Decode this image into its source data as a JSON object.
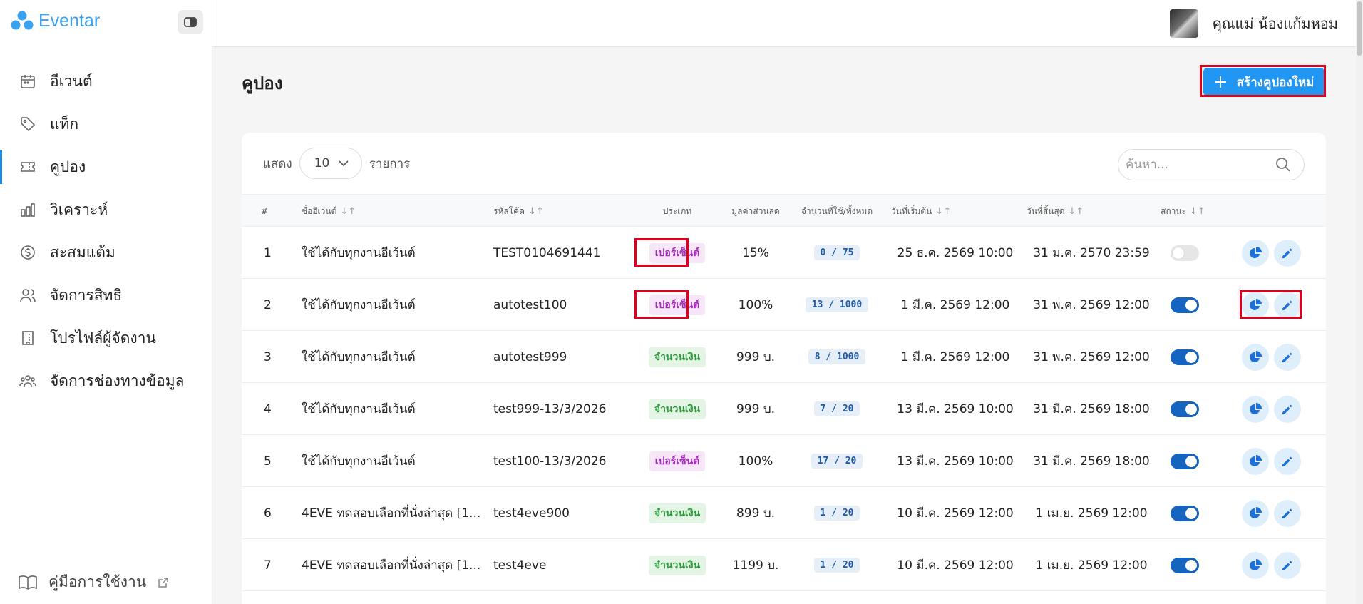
{
  "app": {
    "logo_text": "Eventar"
  },
  "sidebar": {
    "items": [
      {
        "label": "อีเวนต์",
        "icon": "calendar-icon",
        "active": false
      },
      {
        "label": "แท็ก",
        "icon": "tag-icon",
        "active": false
      },
      {
        "label": "คูปอง",
        "icon": "ticket-icon",
        "active": true
      },
      {
        "label": "วิเคราะห์",
        "icon": "bar-chart-icon",
        "active": false
      },
      {
        "label": "สะสมแต้ม",
        "icon": "dollar-circle-icon",
        "active": false
      },
      {
        "label": "จัดการสิทธิ",
        "icon": "users-icon",
        "active": false
      },
      {
        "label": "โปรไฟล์ผู้จัดงาน",
        "icon": "building-icon",
        "active": false
      },
      {
        "label": "จัดการช่องทางข้อมูล",
        "icon": "team-icon",
        "active": false
      }
    ],
    "guide_label": "คู่มือการใช้งาน"
  },
  "topbar": {
    "user_name": "คุณแม่ น้องแก้มหอม"
  },
  "page": {
    "title": "คูปอง",
    "create_label": "สร้างคูปองใหม่"
  },
  "controls": {
    "show_label": "แสดง",
    "page_size": "10",
    "items_label": "รายการ",
    "search_placeholder": "ค้นหา..."
  },
  "table": {
    "headers": {
      "num": "#",
      "event": "ชื่ออีเวนต์",
      "code": "รหัสโค้ด",
      "type": "ประเภท",
      "value": "มูลค่าส่วนลด",
      "usage": "จำนวนที่ใช้/ทั้งหมด",
      "start": "วันที่เริ่มต้น",
      "end": "วันที่สิ้นสุด",
      "status": "สถานะ"
    },
    "rows": [
      {
        "num": "1",
        "event": "ใช้ได้กับทุกงานอีเว้นต์",
        "code": "TEST0104691441",
        "type": "เปอร์เซ็นต์",
        "type_kind": "percent",
        "value": "15%",
        "usage": "0 / 75",
        "start": "25 ธ.ค. 2569 10:00",
        "end": "31 ม.ค. 2570 23:59",
        "status_on": false
      },
      {
        "num": "2",
        "event": "ใช้ได้กับทุกงานอีเว้นต์",
        "code": "autotest100",
        "type": "เปอร์เซ็นต์",
        "type_kind": "percent",
        "value": "100%",
        "usage": "13 / 1000",
        "start": "1 มี.ค. 2569 12:00",
        "end": "31 พ.ค. 2569 12:00",
        "status_on": true
      },
      {
        "num": "3",
        "event": "ใช้ได้กับทุกงานอีเว้นต์",
        "code": "autotest999",
        "type": "จำนวนเงิน",
        "type_kind": "amount",
        "value": "999 บ.",
        "usage": "8 / 1000",
        "start": "1 มี.ค. 2569 12:00",
        "end": "31 พ.ค. 2569 12:00",
        "status_on": true
      },
      {
        "num": "4",
        "event": "ใช้ได้กับทุกงานอีเว้นต์",
        "code": "test999-13/3/2026",
        "type": "จำนวนเงิน",
        "type_kind": "amount",
        "value": "999 บ.",
        "usage": "7 / 20",
        "start": "13 มี.ค. 2569 10:00",
        "end": "31 มี.ค. 2569 18:00",
        "status_on": true
      },
      {
        "num": "5",
        "event": "ใช้ได้กับทุกงานอีเว้นต์",
        "code": "test100-13/3/2026",
        "type": "เปอร์เซ็นต์",
        "type_kind": "percent",
        "value": "100%",
        "usage": "17 / 20",
        "start": "13 มี.ค. 2569 10:00",
        "end": "31 มี.ค. 2569 18:00",
        "status_on": true
      },
      {
        "num": "6",
        "event": "4EVE ทดสอบเลือกที่นั่งล่าสุด [1...",
        "code": "test4eve900",
        "type": "จำนวนเงิน",
        "type_kind": "amount",
        "value": "899 บ.",
        "usage": "1 / 20",
        "start": "10 มี.ค. 2569 12:00",
        "end": "1 เม.ย. 2569 12:00",
        "status_on": true
      },
      {
        "num": "7",
        "event": "4EVE ทดสอบเลือกที่นั่งล่าสุด [1...",
        "code": "test4eve",
        "type": "จำนวนเงิน",
        "type_kind": "amount",
        "value": "1199 บ.",
        "usage": "1 / 20",
        "start": "10 มี.ค. 2569 12:00",
        "end": "1 เม.ย. 2569 12:00",
        "status_on": true
      }
    ]
  },
  "colors": {
    "accent": "#2196f3",
    "highlight": "#e0001b",
    "toggle_on": "#1565c0"
  }
}
